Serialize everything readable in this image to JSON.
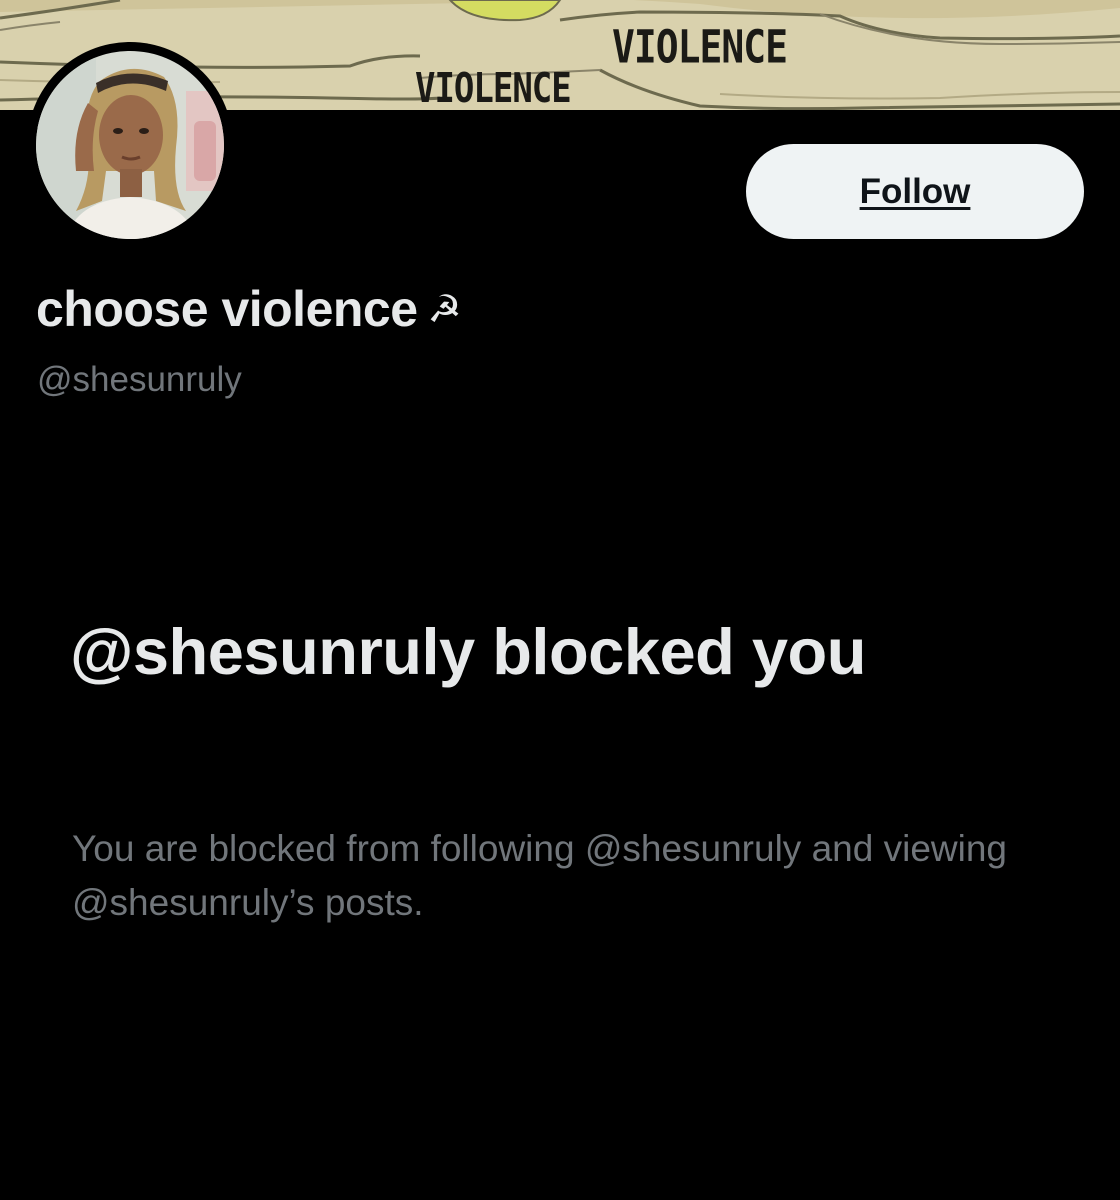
{
  "banner": {
    "labels": [
      "VIOLENCE",
      "VIOLENCE"
    ]
  },
  "profile": {
    "display_name": "choose violence",
    "name_emoji": "☭",
    "handle": "@shesunruly"
  },
  "actions": {
    "follow_label": "Follow"
  },
  "blocked": {
    "title": "@shesunruly blocked you",
    "description": "You are blocked from following @shesunruly and viewing @shesunruly’s posts."
  },
  "colors": {
    "background": "#000000",
    "primary_text": "#e7e9ea",
    "secondary_text": "#71767b",
    "follow_button_bg": "#eff3f4",
    "follow_button_text": "#0f1419",
    "banner_map": "#d9d1ad"
  }
}
